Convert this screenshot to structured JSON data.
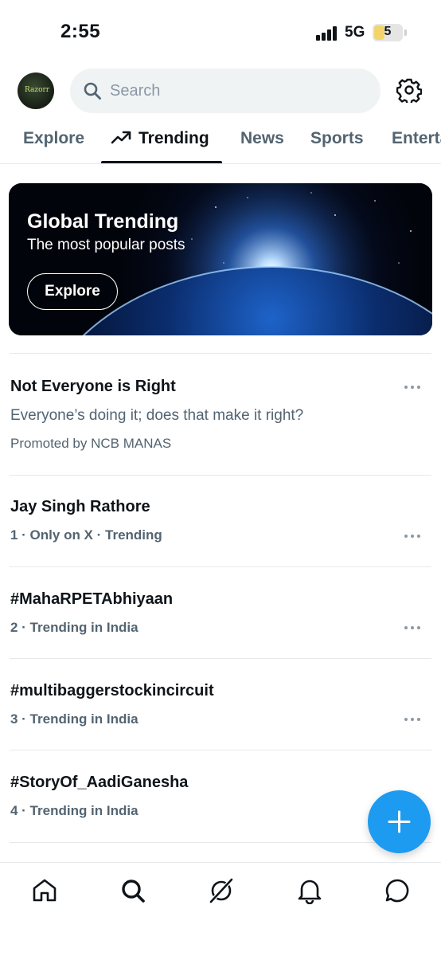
{
  "status_bar": {
    "time": "2:55",
    "network": "5G",
    "battery": "5"
  },
  "header": {
    "avatar_text": "Razorr",
    "search": {
      "placeholder": "Search"
    }
  },
  "tabs": [
    {
      "label": "Explore",
      "active": false
    },
    {
      "label": "Trending",
      "active": true
    },
    {
      "label": "News",
      "active": false
    },
    {
      "label": "Sports",
      "active": false
    },
    {
      "label": "Entertainment",
      "active": false
    }
  ],
  "banner": {
    "title": "Global Trending",
    "subtitle": "The most popular posts",
    "button_label": "Explore"
  },
  "promoted": {
    "title": "Not Everyone is Right",
    "description": "Everyone’s doing it; does that make it right?",
    "promoted_by": "Promoted by NCB MANAS"
  },
  "trends": [
    {
      "title": "Jay Singh Rathore",
      "context": "1 · Only on X · Trending"
    },
    {
      "title": "#MahaRPETAbhiyaan",
      "context": "2 · Trending in India"
    },
    {
      "title": "#multibaggerstockincircuit",
      "context": "3 · Trending in India"
    },
    {
      "title": "#StoryOf_AadiGanesha",
      "context": "4 · Trending in India"
    }
  ],
  "bottom_nav": [
    {
      "icon": "home-icon"
    },
    {
      "icon": "search-icon"
    },
    {
      "icon": "grok-icon"
    },
    {
      "icon": "bell-icon"
    },
    {
      "icon": "messages-icon"
    }
  ],
  "colors": {
    "accent": "#1d9bf0",
    "text": "#0f1419",
    "secondary": "#536471"
  }
}
